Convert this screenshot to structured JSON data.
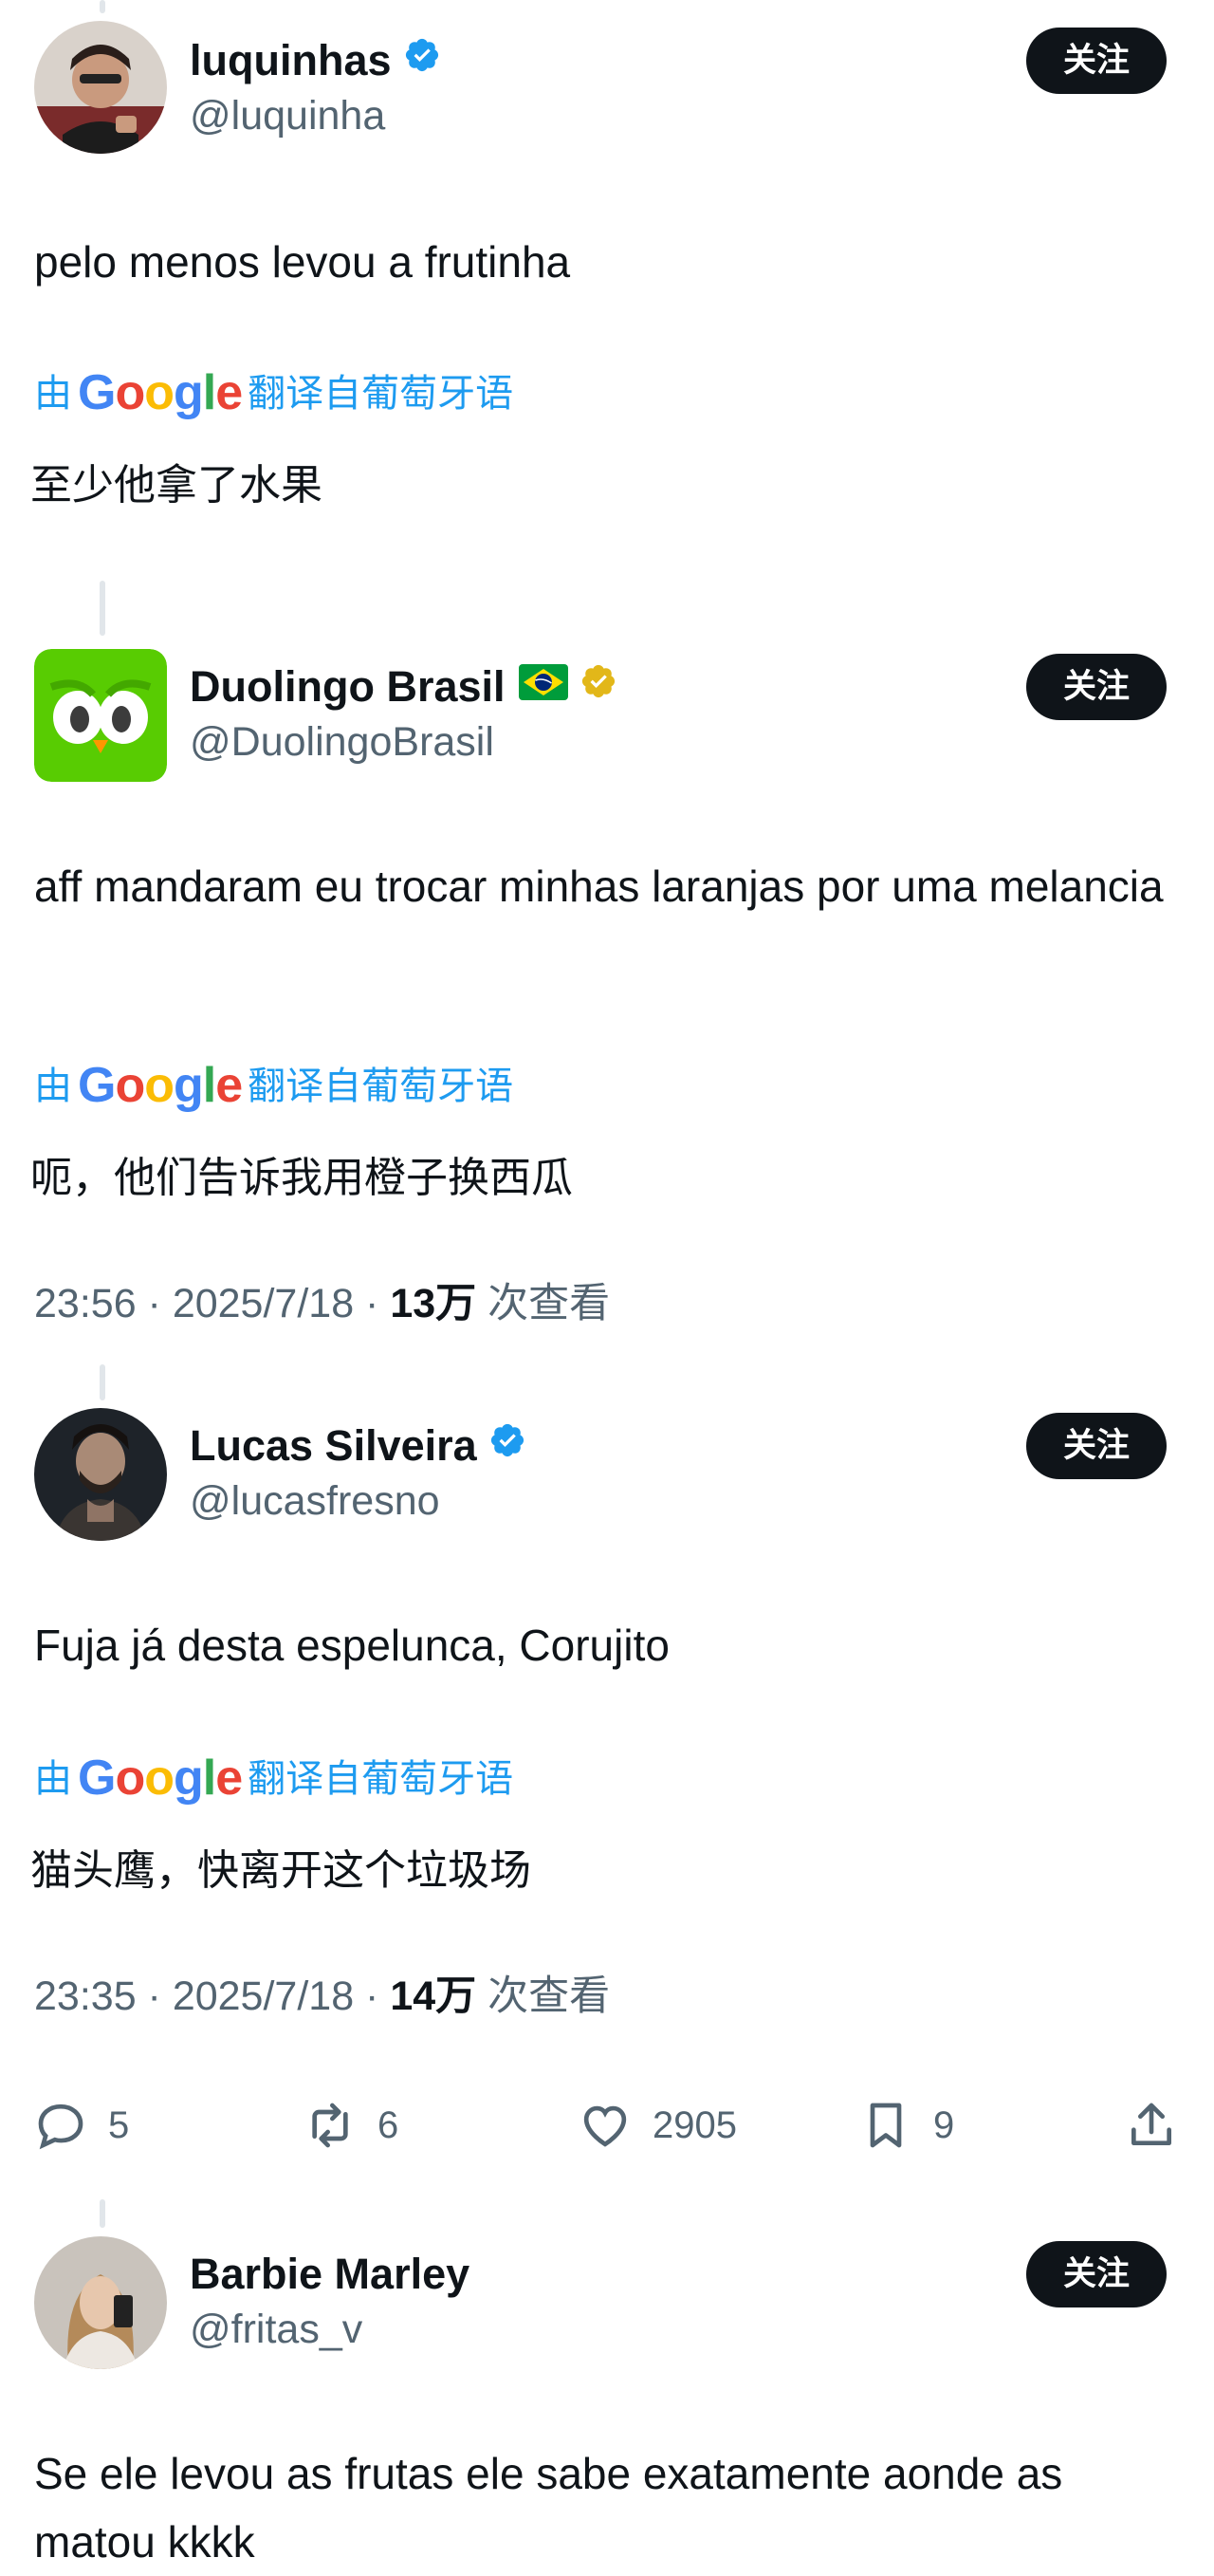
{
  "posts": [
    {
      "name": "luquinhas",
      "handle": "@luquinha",
      "verified": "blue",
      "follow": "关注",
      "text": "pelo menos levou a frutinha",
      "translate_prefix": "由",
      "translate_suffix": "翻译自葡萄牙语",
      "translated": "至少他拿了水果"
    },
    {
      "name": "Duolingo Brasil",
      "handle": "@DuolingoBrasil",
      "verified": "gold",
      "follow": "关注",
      "text": "aff mandaram eu trocar minhas laranjas por uma melancia",
      "translate_prefix": "由",
      "translate_suffix": "翻译自葡萄牙语",
      "translated": "呃，他们告诉我用橙子换西瓜",
      "time": "23:56 · 2025/7/18 · ",
      "views_count": "13万",
      "views_label": " 次查看"
    },
    {
      "name": "Lucas Silveira",
      "handle": "@lucasfresno",
      "verified": "blue",
      "follow": "关注",
      "text": "Fuja já desta espelunca, Corujito",
      "translate_prefix": "由",
      "translate_suffix": "翻译自葡萄牙语",
      "translated": "猫头鹰，快离开这个垃圾场",
      "time": "23:35 · 2025/7/18 · ",
      "views_count": "14万",
      "views_label": " 次查看",
      "actions": {
        "replies": "5",
        "reposts": "6",
        "likes": "2905",
        "bookmarks": "9"
      }
    },
    {
      "name": "Barbie Marley",
      "handle": "@fritas_v",
      "follow": "关注",
      "text": "Se ele levou as frutas ele sabe exatamente aonde as matou kkkk"
    }
  ],
  "google_word": "Google",
  "colors": {
    "link_blue": "#1d9bf0",
    "text": "#0f1419",
    "secondary": "#536471",
    "verified_blue": "#1d9bf0",
    "verified_gold": "#e2b719",
    "duo_green": "#58cc02"
  }
}
